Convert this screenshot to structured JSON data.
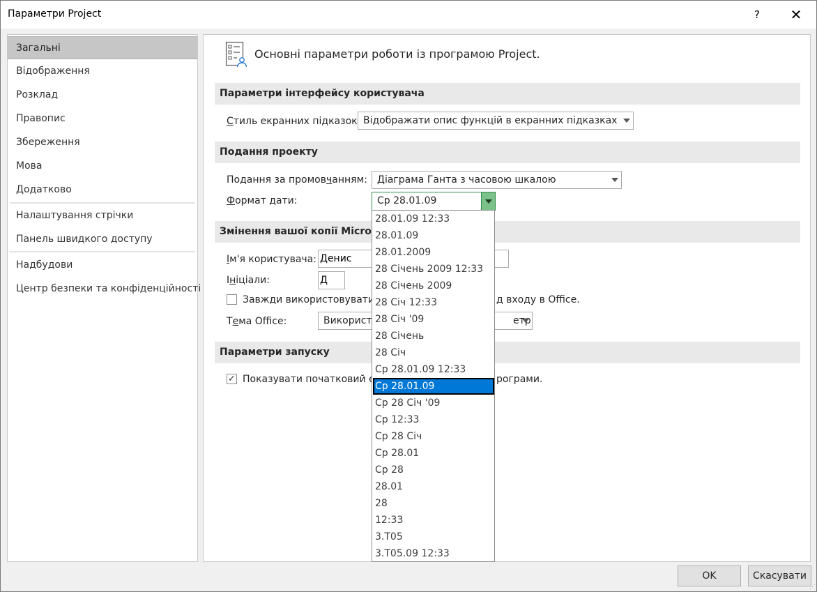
{
  "window": {
    "title": "Параметри Project",
    "help_glyph": "?",
    "close_glyph": "✕"
  },
  "nav": {
    "items": [
      {
        "id": "general",
        "label": "Загальні",
        "selected": true
      },
      {
        "id": "display",
        "label": "Відображення"
      },
      {
        "id": "schedule",
        "label": "Розклад"
      },
      {
        "id": "proofing",
        "label": "Правопис"
      },
      {
        "id": "save",
        "label": "Збереження"
      },
      {
        "id": "language",
        "label": "Мова"
      },
      {
        "id": "advanced",
        "label": "Додатково"
      },
      {
        "id": "ribbon",
        "label": "Налаштування стрічки"
      },
      {
        "id": "qat",
        "label": "Панель швидкого доступу"
      },
      {
        "id": "addins",
        "label": "Надбудови"
      },
      {
        "id": "trust",
        "label": "Центр безпеки та конфіденційності"
      }
    ]
  },
  "header": {
    "icon": "options-list-icon",
    "text": "Основні параметри роботи із програмою Project."
  },
  "sections": {
    "ui": "Параметри інтерфейсу користувача",
    "project_view": "Подання проекту",
    "personalize": "Змінення вашої копії Microsoft Office",
    "startup": "Параметри запуску"
  },
  "ui": {
    "tooltip_label_pre": "С",
    "tooltip_label_rest": "тиль екранних підказок:",
    "tooltip_value": "Відображати опис функцій в екранних підказках"
  },
  "project_view": {
    "default_view_label_pre": "Подання за промов",
    "default_view_label_u": "ч",
    "default_view_label_post": "анням:",
    "default_view_value": "Діаграма Ганта з часовою шкалою",
    "date_format_label_pre": "Ф",
    "date_format_label_rest": "ормат дати:",
    "date_format_value": "Ср 28.01.09"
  },
  "personalize": {
    "username_label_pre": "І",
    "username_label_rest": "м'я користувача:",
    "username_value": "Денис",
    "initials_label_pre": "І",
    "initials_label_u": "н",
    "initials_label_rest": "іціали:",
    "initials_value": "Д",
    "always_use_pre": "Завжди використовувати ц",
    "always_use_post": "д входу в Office.",
    "always_use_checked": false,
    "theme_label_pre": "Т",
    "theme_label_u": "е",
    "theme_label_rest": "ма Office:",
    "theme_value_pre": "Використо",
    "theme_value_post": "етр"
  },
  "startup": {
    "show_start_pre": "Показувати початковий ек",
    "show_start_post": "рограми.",
    "show_start_checked": true
  },
  "date_dropdown": {
    "items": [
      "28.01.09 12:33",
      "28.01.09",
      "28.01.2009",
      "28 Січень 2009 12:33",
      "28 Січень 2009",
      "28 Січ 12:33",
      "28 Січ '09",
      "28 Січень",
      "28 Січ",
      "Ср 28.01.09 12:33",
      "Ср 28.01.09",
      "Ср 28 Січ '09",
      "Ср 12:33",
      "Ср 28 Січ",
      "Ср 28.01",
      "Ср 28",
      "28.01",
      "28",
      "12:33",
      "3.Т05",
      "3.Т05.09 12:33"
    ],
    "selected": "Ср 28.01.09"
  },
  "buttons": {
    "ok": "OK",
    "cancel": "Скасувати"
  },
  "colors": {
    "accent_selection": "#0078d7",
    "combo_active_border": "#2f8f4a",
    "combo_button": "#7cc08a"
  }
}
